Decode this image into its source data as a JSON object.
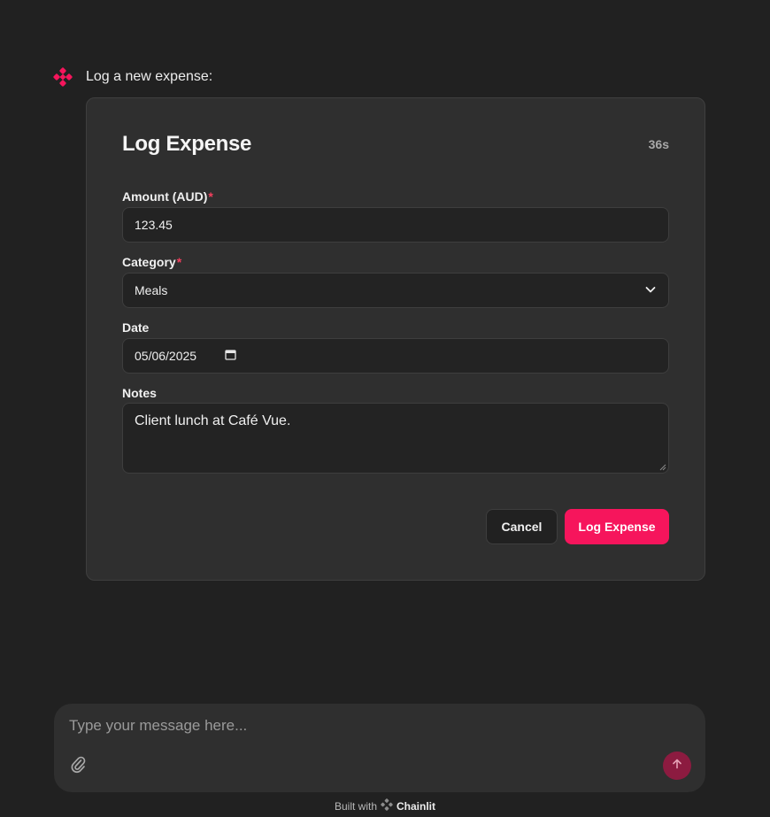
{
  "message": {
    "text": "Log a new expense:",
    "avatar_icon": "chainlit-logo",
    "accent": "#f6155c"
  },
  "form": {
    "title": "Log Expense",
    "timer": "36s",
    "amount": {
      "label": "Amount (AUD)",
      "required_mark": "*",
      "value": "123.45"
    },
    "category": {
      "label": "Category",
      "required_mark": "*",
      "value": "Meals",
      "icon": "chevron-down-icon"
    },
    "date": {
      "label": "Date",
      "value": "05/06/2025",
      "icon": "calendar-icon"
    },
    "notes": {
      "label": "Notes",
      "value": "Client lunch at Café Vue."
    },
    "buttons": {
      "cancel": "Cancel",
      "submit": "Log Expense"
    }
  },
  "composer": {
    "placeholder": "Type your message here...",
    "attach_icon": "paperclip-icon",
    "send_icon": "arrow-up-icon"
  },
  "footer": {
    "prefix": "Built with",
    "brand": "Chainlit"
  }
}
